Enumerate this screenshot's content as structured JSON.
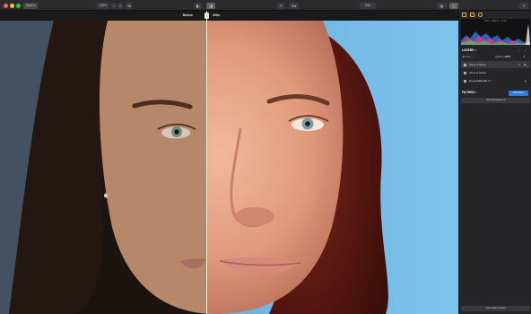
{
  "toolbar": {
    "open_label": "Open ▾",
    "zoom_label": "100%",
    "zoom_minus": "−",
    "zoom_plus": "+",
    "undo_glyph": "↶",
    "edit_label": "Edit",
    "export_glyph": "⇪"
  },
  "compare": {
    "before_label": "Before",
    "after_label": "After"
  },
  "panel": {
    "histogram_caption": "3471 × 4901 px · 16 bit",
    "layers_title": "LAYERS",
    "normal_label": "Normal",
    "opacity_label": "Opacity",
    "opacity_value": "100%",
    "layers": [
      {
        "name": "Clone & Stamp",
        "selected": true
      },
      {
        "name": "Clone & Stamp",
        "selected": false
      },
      {
        "name": "ExampleBackfile.tif",
        "selected": false
      }
    ],
    "filters_title": "FILTERS",
    "add_filters_label": "Add Filters",
    "workspace_label": "Clear Workspace ▾",
    "save_preset_label": "Save Filters Preset"
  },
  "colors": {
    "accent": "#2a7be4",
    "panel_icon": "#f4b400",
    "divider": "#f0e6d2"
  }
}
